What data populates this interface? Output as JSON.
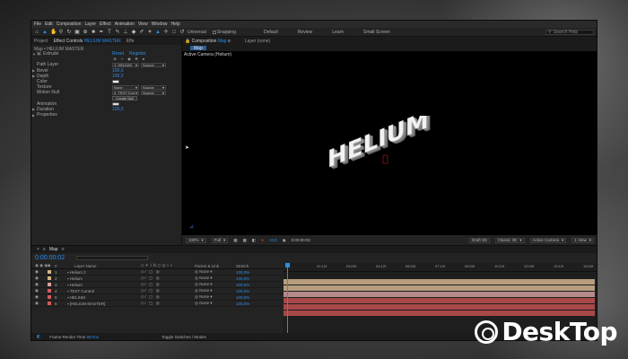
{
  "menu": [
    "File",
    "Edit",
    "Composition",
    "Layer",
    "Effect",
    "Animation",
    "View",
    "Window",
    "Help"
  ],
  "toolbar": {
    "universal_label": "Universal",
    "snapping_label": "Snapping",
    "workspaces": [
      "Default",
      "Review",
      "Learn",
      "Small Screen"
    ],
    "search_placeholder": "Search Help"
  },
  "left_panel": {
    "tabs": [
      {
        "label": "Project",
        "active": false
      },
      {
        "label": "Effect Controls",
        "accent": "HELIUM MASTER",
        "active": true
      },
      {
        "label": "Effe",
        "active": false
      }
    ],
    "header": "Map • HELIUM MASTER",
    "effect_name": "Extrude",
    "effect_links": {
      "reset": "Reset",
      "register": "Register"
    },
    "rows": [
      {
        "label": "Path Layer",
        "value": "1. HELIUM",
        "extra": "Source"
      },
      {
        "label": "Bevel",
        "value": "100,0"
      },
      {
        "label": "Depth",
        "value": "100,0"
      },
      {
        "label": "Color",
        "value": ""
      },
      {
        "label": "Texture",
        "value": "None",
        "extra": "Source"
      },
      {
        "label": "Motion Null",
        "value": "4. TEXT Con",
        "extra": "Source"
      },
      {
        "label": "",
        "value": "Create Null"
      },
      {
        "label": "Animation",
        "value": ""
      },
      {
        "label": "Duration",
        "value": "100,0"
      },
      {
        "label": "Properties",
        "value": ""
      }
    ]
  },
  "comp_panel": {
    "tabs": [
      {
        "label": "Composition",
        "accent": "Map",
        "active": true
      },
      {
        "label": "Layer",
        "accent": "(none)",
        "active": false
      }
    ],
    "comp_chip": "Map",
    "view_label": "Active Camera (Helium)",
    "scene_text": "HELIUM",
    "bottom": {
      "zoom": "100%",
      "resolution": "Full",
      "timecode": "0:00:00:02",
      "renderer": "Draft 3D",
      "renderer_mode": "Classic 3D",
      "camera": "Active Camera",
      "views": "1 View",
      "exposure": "+0,0"
    }
  },
  "timeline": {
    "tab": "Map",
    "timecode": "0:00:00:02",
    "columns": {
      "source": "Layer Name",
      "parent": "Parent & Link",
      "stretch": "Stretch"
    },
    "layers": [
      {
        "num": "1",
        "name": "Helium 2",
        "parent": "None",
        "stretch": "100,0%",
        "label_color": "#d4b586",
        "bar_color": "#b59d7e"
      },
      {
        "num": "2",
        "name": "Helium",
        "parent": "None",
        "stretch": "100,0%",
        "label_color": "#d4b586",
        "bar_color": "#b59d7e"
      },
      {
        "num": "3",
        "name": "Helium",
        "parent": "None",
        "stretch": "100,0%",
        "label_color": "#d9a3a3",
        "bar_color": "#b58a8a"
      },
      {
        "num": "4",
        "name": "TEXT Control",
        "parent": "None",
        "stretch": "100,0%",
        "label_color": "#d45a5a",
        "bar_color": "#a84848"
      },
      {
        "num": "5",
        "name": "HELIUM",
        "parent": "None",
        "stretch": "100,0%",
        "label_color": "#d45a5a",
        "bar_color": "#a84848"
      },
      {
        "num": "6",
        "name": "[HELIUM MASTER]",
        "parent": "None",
        "stretch": "100,0%",
        "label_color": "#d45a5a",
        "bar_color": "#a84848"
      }
    ],
    "ruler": [
      "0f",
      "01:12f",
      "03:00f",
      "04:12f",
      "06:00f",
      "07:12f",
      "09:00f",
      "10:12f",
      "12:00f",
      "13:12f",
      "15:00f"
    ],
    "footer_left": "Frame Render Time",
    "footer_time": "957ms",
    "footer_toggle": "Toggle Switches / Modes"
  },
  "watermark": {
    "text": "DeskTop"
  },
  "colors": {
    "accent": "#2d8ceb"
  }
}
